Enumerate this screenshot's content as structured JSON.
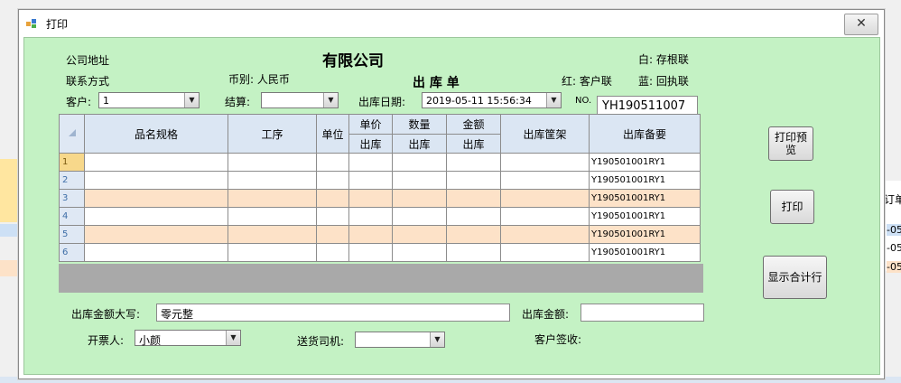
{
  "window": {
    "title": "打印",
    "close_glyph": "✕"
  },
  "background": {
    "right_header": "订单",
    "right_cells": [
      "-05",
      "-05",
      "-05"
    ],
    "bottom_labels": [
      "单价",
      "数量",
      "金额"
    ]
  },
  "header": {
    "company_address_label": "公司地址",
    "company_name": "有限公司",
    "copy_white": "白: 存根联",
    "contact_label": "联系方式",
    "currency_label": "币别: 人民币",
    "doc_title": "出 库 单",
    "copy_red": "红: 客户联",
    "copy_blue": "蓝: 回执联"
  },
  "filters": {
    "customer_label": "客户:",
    "customer_value": "1",
    "settlement_label": "结算:",
    "settlement_value": "",
    "date_label": "出库日期:",
    "date_value": "2019-05-11 15:56:34",
    "no_label": "NO.",
    "no_value": "YH190511007"
  },
  "grid": {
    "columns": {
      "name": "品名规格",
      "process": "工序",
      "unit": "单位",
      "price": "单价",
      "qty": "数量",
      "amount": "金额",
      "out": "出库",
      "shelf": "出库筐架",
      "remark": "出库备要"
    },
    "rows": [
      {
        "num": "1",
        "remark": "Y190501001RY1"
      },
      {
        "num": "2",
        "remark": "Y190501001RY1"
      },
      {
        "num": "3",
        "remark": "Y190501001RY1"
      },
      {
        "num": "4",
        "remark": "Y190501001RY1"
      },
      {
        "num": "5",
        "remark": "Y190501001RY1"
      },
      {
        "num": "6",
        "remark": "Y190501001RY1"
      }
    ]
  },
  "buttons": {
    "preview": "打印预览",
    "print": "打印",
    "total": "显示合计行"
  },
  "footer": {
    "amount_words_label": "出库金额大写:",
    "amount_words_value": "零元整",
    "amount_label": "出库金额:",
    "amount_value": "",
    "issuer_label": "开票人:",
    "issuer_value": "小颜",
    "driver_label": "送货司机:",
    "driver_value": "",
    "customer_sign_label": "客户签收:"
  }
}
